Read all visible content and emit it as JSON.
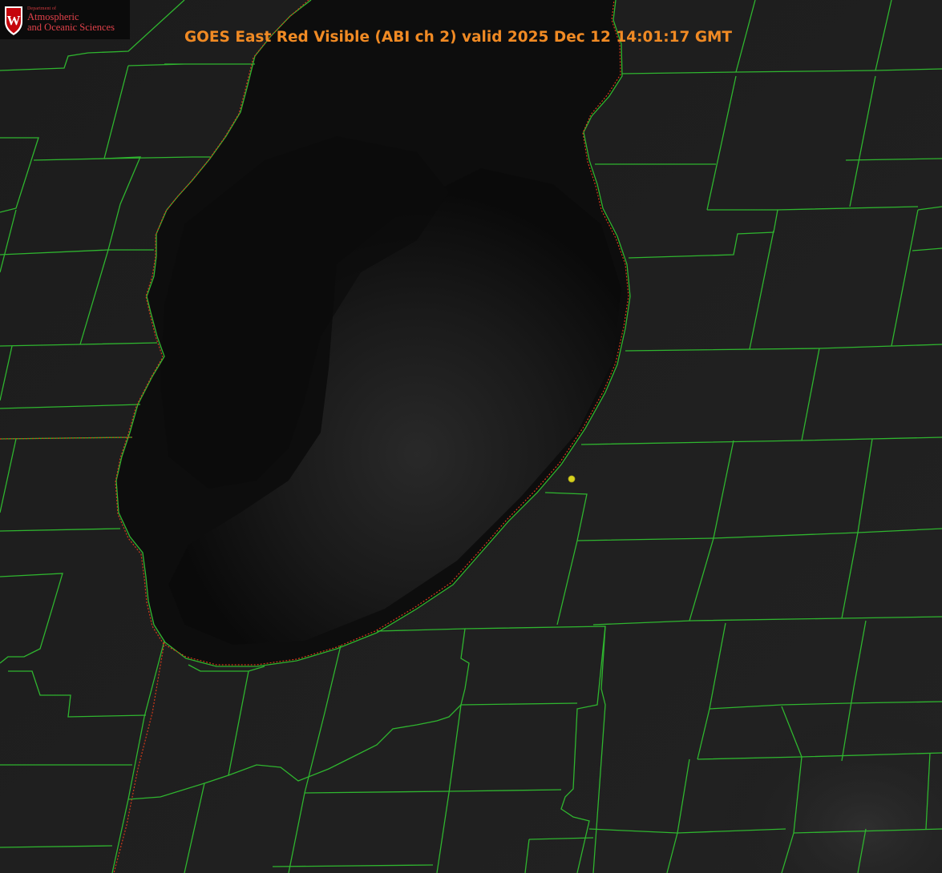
{
  "title": "GOES East Red Visible (ABI ch 2) valid 2025 Dec 12 14:01:17 GMT",
  "logo": {
    "crest_letter": "W",
    "department_line": "Department of",
    "line1": "Atmospheric",
    "line2": "and Oceanic Sciences"
  },
  "colors": {
    "title": "#f08a24",
    "county_lines": "#2fb52f",
    "state_line": "#d23a1a",
    "marker": "#d7d21e",
    "logo_red": "#c5050c"
  },
  "map_features": {
    "lake": "Lake Michigan",
    "marker_icon": "station-dot"
  }
}
